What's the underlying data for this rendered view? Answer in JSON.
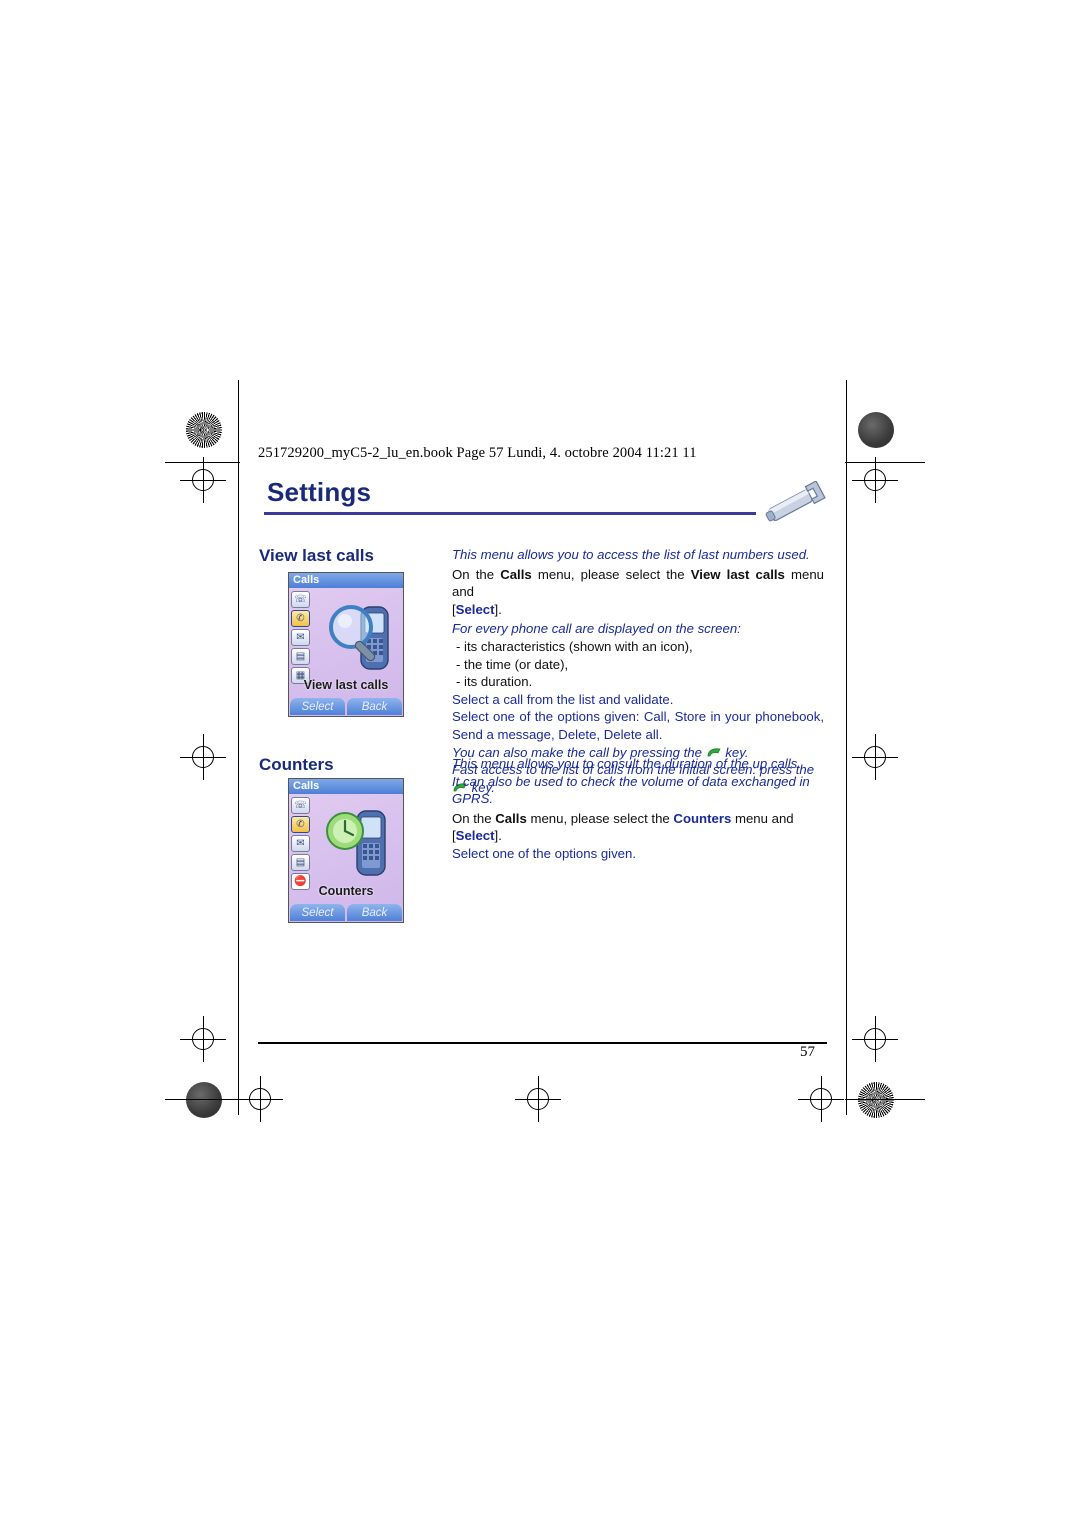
{
  "document": {
    "header_line": "251729200_myC5-2_lu_en.book  Page 57  Lundi, 4. octobre 2004  11:21 11",
    "chapter_title": "Settings",
    "page_number": "57"
  },
  "sections": [
    {
      "heading": "View last calls",
      "screenshot": {
        "titlebar": "Calls",
        "caption": "View last calls",
        "softkey_left": "Select",
        "softkey_right": "Back"
      },
      "paragraphs": [
        {
          "style": "italic-blue",
          "text": "This menu allows you to access the list of last numbers used."
        },
        {
          "style": "normal-justified",
          "segments": [
            {
              "t": "On the ",
              "b": false
            },
            {
              "t": "Calls",
              "b": true
            },
            {
              "t": " menu, please select the ",
              "b": false
            },
            {
              "t": "View last calls",
              "b": true
            },
            {
              "t": " menu and [",
              "b": false
            },
            {
              "t": "Select",
              "b": true
            },
            {
              "t": "].",
              "b": false
            }
          ]
        },
        {
          "style": "italic-blue",
          "text": "For every phone call are displayed on the screen:"
        },
        {
          "style": "bullet",
          "text": "-  its characteristics (shown with an icon),"
        },
        {
          "style": "bullet",
          "text": "-  the time (or date),"
        },
        {
          "style": "bullet",
          "text": "-  its duration."
        },
        {
          "style": "blue",
          "text": "Select a call from the list and validate."
        },
        {
          "style": "blue",
          "text": "Select one of the options given: Call, Store in your phonebook, Send a message, Delete, Delete all."
        },
        {
          "style": "italic-blue-key",
          "text_before": "You can also make the call by pressing the",
          "text_after": "key."
        },
        {
          "style": "italic-blue-key",
          "text_before": "Fast access to the list of calls from the initial screen: press the",
          "text_after": "key."
        }
      ]
    },
    {
      "heading": "Counters",
      "screenshot": {
        "titlebar": "Calls",
        "caption": "Counters",
        "softkey_left": "Select",
        "softkey_right": "Back"
      },
      "paragraphs": [
        {
          "style": "italic-blue",
          "text": "This menu allows you to consult the duration of the up calls."
        },
        {
          "style": "italic-blue",
          "text": "It can also be used to check the volume of data exchanged in GPRS."
        },
        {
          "style": "normal",
          "segments": [
            {
              "t": "On the ",
              "b": false
            },
            {
              "t": "Calls",
              "b": true
            },
            {
              "t": " menu, please select the ",
              "b": false
            },
            {
              "t": "Counters",
              "b": true
            },
            {
              "t": " menu and [",
              "b": false
            },
            {
              "t": "Select",
              "b": true
            },
            {
              "t": "].",
              "b": false
            }
          ]
        },
        {
          "style": "blue",
          "text": "Select one of the options given."
        }
      ]
    }
  ],
  "colors": {
    "heading_blue": "#1a2a7a",
    "body_blue": "#1a2a9a",
    "green_key": "#2aaa3a"
  }
}
